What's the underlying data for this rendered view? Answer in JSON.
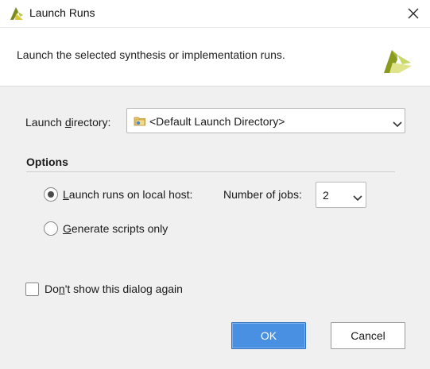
{
  "window": {
    "title": "Launch Runs",
    "close_icon": "close-icon",
    "app_icon": "vivado-logo-icon"
  },
  "header": {
    "description": "Launch the selected synthesis or implementation runs.",
    "logo_icon": "vivado-logo-icon"
  },
  "launch_directory": {
    "label_pre": "Launch ",
    "label_underline": "d",
    "label_post": "irectory:",
    "value": "<Default Launch Directory>",
    "folder_icon": "folder-icon"
  },
  "options": {
    "title": "Options",
    "local_host": {
      "label_underline": "L",
      "label_post": "aunch runs on local host:",
      "selected": true
    },
    "jobs": {
      "label_pre": "Number of ",
      "label_underline": "j",
      "label_post": "obs:",
      "value": "2"
    },
    "scripts_only": {
      "label_underline": "G",
      "label_post": "enerate scripts only",
      "selected": false
    }
  },
  "dont_show": {
    "label_pre": "Do",
    "label_underline": "n",
    "label_post": "'t show this dialog again",
    "checked": false
  },
  "buttons": {
    "ok": "OK",
    "cancel": "Cancel"
  },
  "colors": {
    "accent": "#4a90e2",
    "logo_dark": "#7a8a1e",
    "logo_light": "#c8d86a"
  }
}
